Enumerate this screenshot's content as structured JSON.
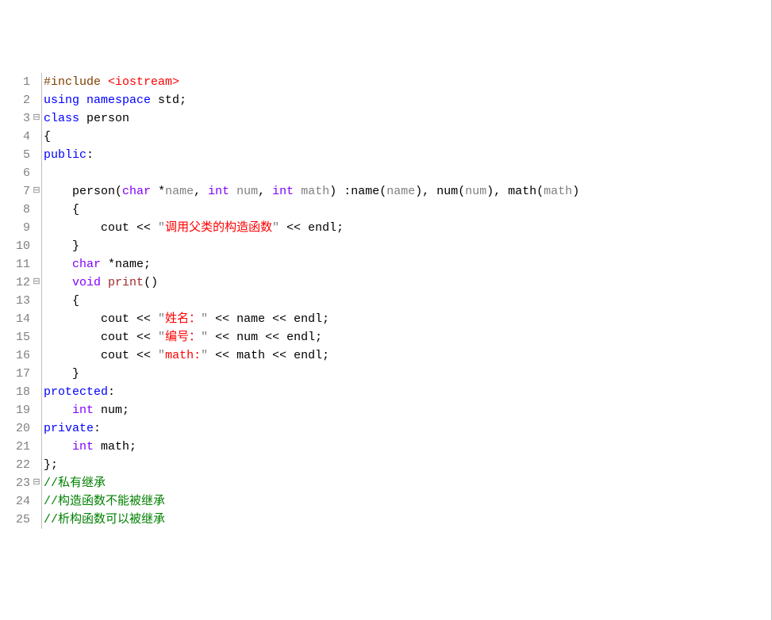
{
  "lines": [
    {
      "n": 1,
      "fold": "",
      "tokens": [
        {
          "cls": "preproc",
          "t": "#include "
        },
        {
          "cls": "strred",
          "t": "<iostream>"
        }
      ]
    },
    {
      "n": 2,
      "fold": "",
      "tokens": [
        {
          "cls": "keyword",
          "t": "using"
        },
        {
          "cls": "punct",
          "t": " "
        },
        {
          "cls": "keyword",
          "t": "namespace"
        },
        {
          "cls": "punct",
          "t": " std"
        },
        {
          "cls": "punct",
          "t": ";"
        }
      ]
    },
    {
      "n": 3,
      "fold": "⊟",
      "tokens": [
        {
          "cls": "keyword",
          "t": "class"
        },
        {
          "cls": "punct",
          "t": " "
        },
        {
          "cls": "ident",
          "t": "person"
        }
      ]
    },
    {
      "n": 4,
      "fold": "",
      "tokens": [
        {
          "cls": "punct",
          "t": "{"
        }
      ]
    },
    {
      "n": 5,
      "fold": "",
      "tokens": [
        {
          "cls": "keyword",
          "t": "public"
        },
        {
          "cls": "punct",
          "t": ":"
        }
      ]
    },
    {
      "n": 6,
      "fold": "",
      "tokens": [
        {
          "cls": "punct",
          "t": ""
        }
      ]
    },
    {
      "n": 7,
      "fold": "⊟",
      "tokens": [
        {
          "cls": "punct",
          "t": "    "
        },
        {
          "cls": "ident",
          "t": "person"
        },
        {
          "cls": "punct",
          "t": "("
        },
        {
          "cls": "type",
          "t": "char"
        },
        {
          "cls": "punct",
          "t": " *"
        },
        {
          "cls": "param",
          "t": "name"
        },
        {
          "cls": "punct",
          "t": ", "
        },
        {
          "cls": "type",
          "t": "int"
        },
        {
          "cls": "punct",
          "t": " "
        },
        {
          "cls": "param",
          "t": "num"
        },
        {
          "cls": "punct",
          "t": ", "
        },
        {
          "cls": "type",
          "t": "int"
        },
        {
          "cls": "punct",
          "t": " "
        },
        {
          "cls": "param",
          "t": "math"
        },
        {
          "cls": "punct",
          "t": ") :name("
        },
        {
          "cls": "param",
          "t": "name"
        },
        {
          "cls": "punct",
          "t": "), num("
        },
        {
          "cls": "param",
          "t": "num"
        },
        {
          "cls": "punct",
          "t": "), math("
        },
        {
          "cls": "param",
          "t": "math"
        },
        {
          "cls": "punct",
          "t": ")"
        }
      ]
    },
    {
      "n": 8,
      "fold": "",
      "tokens": [
        {
          "cls": "punct",
          "t": "    {"
        }
      ]
    },
    {
      "n": 9,
      "fold": "",
      "tokens": [
        {
          "cls": "punct",
          "t": "        cout "
        },
        {
          "cls": "punct",
          "t": "<< "
        },
        {
          "cls": "string",
          "t": "\""
        },
        {
          "cls": "strred",
          "t": "调用父类的构造函数"
        },
        {
          "cls": "string",
          "t": "\""
        },
        {
          "cls": "punct",
          "t": " << endl"
        },
        {
          "cls": "punct",
          "t": ";"
        }
      ]
    },
    {
      "n": 10,
      "fold": "",
      "tokens": [
        {
          "cls": "punct",
          "t": "    }"
        }
      ]
    },
    {
      "n": 11,
      "fold": "",
      "tokens": [
        {
          "cls": "punct",
          "t": "    "
        },
        {
          "cls": "type",
          "t": "char"
        },
        {
          "cls": "punct",
          "t": " *name"
        },
        {
          "cls": "punct",
          "t": ";"
        }
      ]
    },
    {
      "n": 12,
      "fold": "⊟",
      "tokens": [
        {
          "cls": "punct",
          "t": "    "
        },
        {
          "cls": "type",
          "t": "void"
        },
        {
          "cls": "punct",
          "t": " "
        },
        {
          "cls": "func",
          "t": "print"
        },
        {
          "cls": "punct",
          "t": "()"
        }
      ]
    },
    {
      "n": 13,
      "fold": "",
      "tokens": [
        {
          "cls": "punct",
          "t": "    {"
        }
      ]
    },
    {
      "n": 14,
      "fold": "",
      "tokens": [
        {
          "cls": "punct",
          "t": "        cout "
        },
        {
          "cls": "punct",
          "t": "<< "
        },
        {
          "cls": "string",
          "t": "\""
        },
        {
          "cls": "strred",
          "t": "姓名："
        },
        {
          "cls": "string",
          "t": "\""
        },
        {
          "cls": "punct",
          "t": " << name << endl"
        },
        {
          "cls": "punct",
          "t": ";"
        }
      ]
    },
    {
      "n": 15,
      "fold": "",
      "tokens": [
        {
          "cls": "punct",
          "t": "        cout "
        },
        {
          "cls": "punct",
          "t": "<< "
        },
        {
          "cls": "string",
          "t": "\""
        },
        {
          "cls": "strred",
          "t": "编号："
        },
        {
          "cls": "string",
          "t": "\""
        },
        {
          "cls": "punct",
          "t": " << num << endl"
        },
        {
          "cls": "punct",
          "t": ";"
        }
      ]
    },
    {
      "n": 16,
      "fold": "",
      "tokens": [
        {
          "cls": "punct",
          "t": "        cout "
        },
        {
          "cls": "punct",
          "t": "<< "
        },
        {
          "cls": "string",
          "t": "\""
        },
        {
          "cls": "strred",
          "t": "math:"
        },
        {
          "cls": "string",
          "t": "\""
        },
        {
          "cls": "punct",
          "t": " << math << endl"
        },
        {
          "cls": "punct",
          "t": ";"
        }
      ]
    },
    {
      "n": 17,
      "fold": "",
      "tokens": [
        {
          "cls": "punct",
          "t": "    }"
        }
      ]
    },
    {
      "n": 18,
      "fold": "",
      "tokens": [
        {
          "cls": "keyword",
          "t": "protected"
        },
        {
          "cls": "punct",
          "t": ":"
        }
      ]
    },
    {
      "n": 19,
      "fold": "",
      "tokens": [
        {
          "cls": "punct",
          "t": "    "
        },
        {
          "cls": "type",
          "t": "int"
        },
        {
          "cls": "punct",
          "t": " num"
        },
        {
          "cls": "punct",
          "t": ";"
        }
      ]
    },
    {
      "n": 20,
      "fold": "",
      "tokens": [
        {
          "cls": "keyword",
          "t": "private"
        },
        {
          "cls": "punct",
          "t": ":"
        }
      ]
    },
    {
      "n": 21,
      "fold": "",
      "tokens": [
        {
          "cls": "punct",
          "t": "    "
        },
        {
          "cls": "type",
          "t": "int"
        },
        {
          "cls": "punct",
          "t": " math"
        },
        {
          "cls": "punct",
          "t": ";"
        }
      ]
    },
    {
      "n": 22,
      "fold": "",
      "tokens": [
        {
          "cls": "punct",
          "t": "}"
        },
        {
          "cls": "punct",
          "t": ";"
        }
      ]
    },
    {
      "n": 23,
      "fold": "⊟",
      "tokens": [
        {
          "cls": "comment",
          "t": "//私有继承"
        }
      ]
    },
    {
      "n": 24,
      "fold": "",
      "tokens": [
        {
          "cls": "comment",
          "t": "//构造函数不能被继承"
        }
      ]
    },
    {
      "n": 25,
      "fold": "",
      "tokens": [
        {
          "cls": "comment",
          "t": "//析构函数可以被继承"
        }
      ]
    }
  ]
}
